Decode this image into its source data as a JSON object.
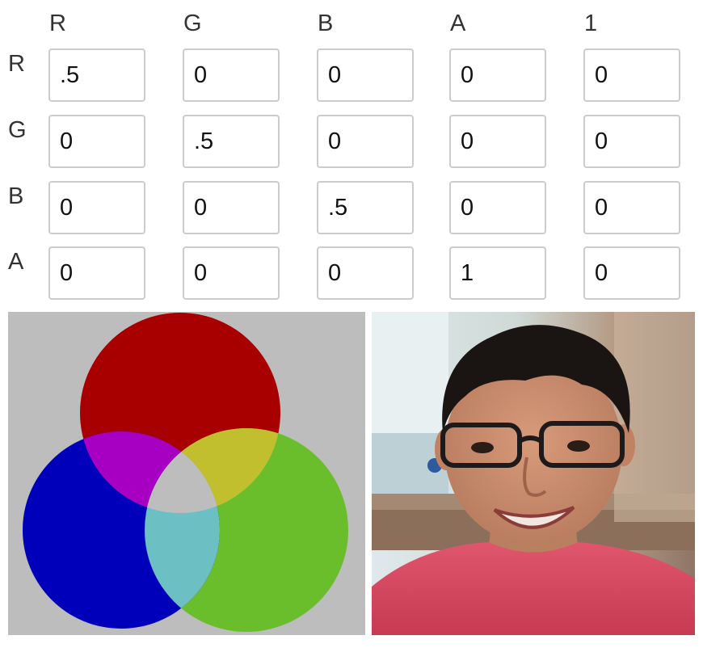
{
  "matrix": {
    "columns": [
      "R",
      "G",
      "B",
      "A",
      "1"
    ],
    "rows": [
      {
        "label": "R",
        "values": [
          ".5",
          "0",
          "0",
          "0",
          "0"
        ]
      },
      {
        "label": "G",
        "values": [
          "0",
          ".5",
          "0",
          "0",
          "0"
        ]
      },
      {
        "label": "B",
        "values": [
          "0",
          "0",
          ".5",
          "0",
          "0"
        ]
      },
      {
        "label": "A",
        "values": [
          "0",
          "0",
          "0",
          "1",
          "0"
        ]
      }
    ]
  },
  "venn_panel": {
    "background": "#bdbdbd",
    "colors": {
      "red": "#a80000",
      "green": "#6abe2c",
      "blue": "#0000bb",
      "magenta": "#a800c2",
      "yellow": "#c1bf2e",
      "cyan": "#6cbfc2",
      "center": "#bdbdbd"
    }
  },
  "photo_panel": {
    "subject": "portrait photo of a smiling man with glasses",
    "colors": {
      "shirt": "#d8455e",
      "skin": "#c88d6e",
      "hair": "#1a1512",
      "background": "#b9a490"
    }
  }
}
